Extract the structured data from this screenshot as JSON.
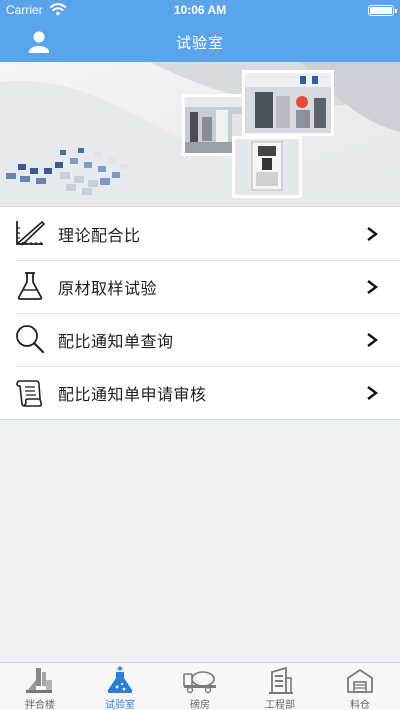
{
  "status_bar": {
    "carrier": "Carrier",
    "time": "10:06 AM",
    "battery_level": 1.0
  },
  "nav": {
    "title": "试验室",
    "left_icon": "user-icon"
  },
  "banner": {
    "icon": "lab-photo-collage"
  },
  "menu": {
    "items": [
      {
        "label": "理论配合比",
        "icon": "ruler-pencil-icon",
        "arrow": ">"
      },
      {
        "label": "原材取样试验",
        "icon": "flask-icon",
        "arrow": ">"
      },
      {
        "label": "配比通知单查询",
        "icon": "magnifier-icon",
        "arrow": ">"
      },
      {
        "label": "配比通知单申请审核",
        "icon": "document-review-icon",
        "arrow": ">"
      }
    ]
  },
  "tabbar": {
    "active_color": "#2b7fd8",
    "items": [
      {
        "label": "拌合楼",
        "icon": "mixing-plant-icon",
        "active": false
      },
      {
        "label": "试验室",
        "icon": "lab-flask-icon",
        "active": true
      },
      {
        "label": "磅房",
        "icon": "mixer-truck-icon",
        "active": false
      },
      {
        "label": "工程部",
        "icon": "building-icon",
        "active": false
      },
      {
        "label": "料仓",
        "icon": "warehouse-icon",
        "active": false
      }
    ]
  },
  "colors": {
    "nav_bg": "#5aa4ec",
    "page_bg": "#eff0f4",
    "accent": "#2b7fd8"
  }
}
